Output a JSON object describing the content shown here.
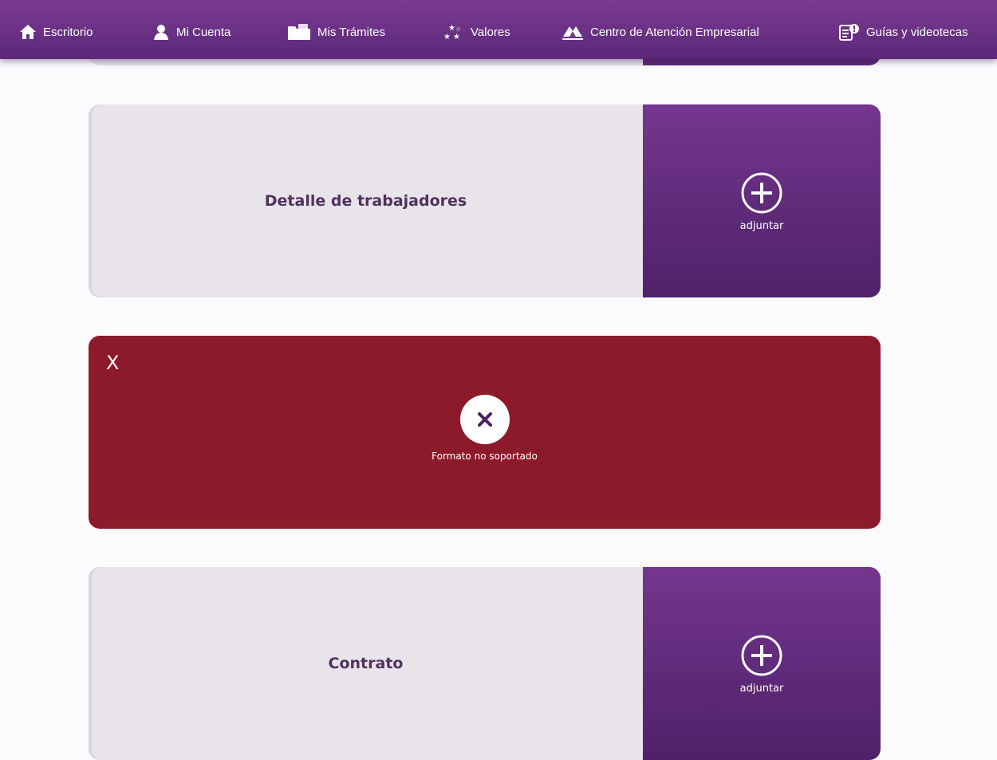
{
  "nav": {
    "items": [
      {
        "label": "Escritorio",
        "icon": "home-icon"
      },
      {
        "label": "Mi Cuenta",
        "icon": "user-icon"
      },
      {
        "label": "Mis Trámites",
        "icon": "folder-icon"
      },
      {
        "label": "Valores",
        "icon": "stars-icon"
      },
      {
        "label": "Centro de Atención Empresarial",
        "icon": "building-icon"
      },
      {
        "label": "Guías y videotecas",
        "icon": "guide-info-icon"
      }
    ]
  },
  "documents": [
    {
      "label": "Detalle de trabajadores",
      "attach_label": "adjuntar",
      "status": "empty"
    },
    {
      "label": "",
      "status": "error",
      "close_label": "X",
      "error_message": "Formato no soportado"
    },
    {
      "label": "Contrato",
      "attach_label": "adjuntar",
      "status": "empty"
    }
  ],
  "colors": {
    "nav_purple": "#6a2f85",
    "panel_purple": "#5f2a7a",
    "card_gray": "#e8e4ea",
    "error_red": "#8d1a2a",
    "label_text": "#4f3260"
  }
}
